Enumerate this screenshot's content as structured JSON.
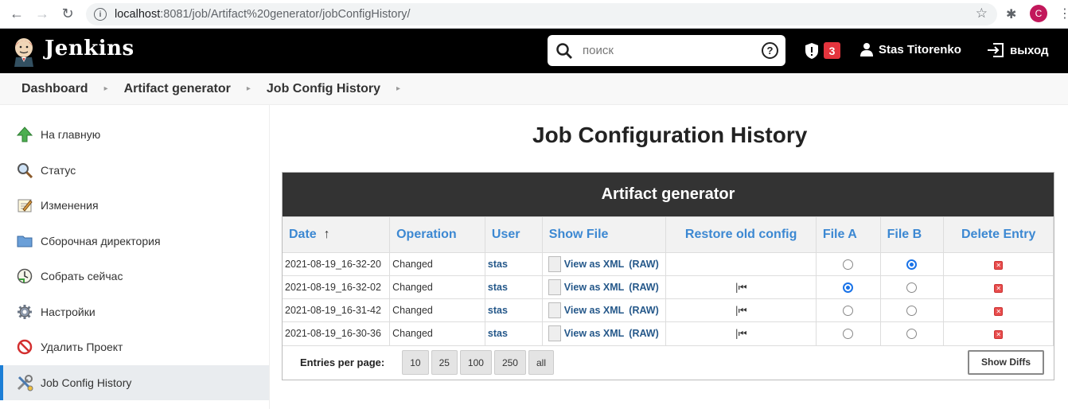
{
  "browser": {
    "url_host": "localhost",
    "url_rest": ":8081/job/Artifact%20generator/jobConfigHistory/",
    "profile_initial": "C"
  },
  "header": {
    "title": "Jenkins",
    "search_placeholder": "поиск",
    "help_glyph": "?",
    "alert_count": "3",
    "user_name": "Stas Titorenko",
    "logout_label": "выход"
  },
  "breadcrumb": [
    "Dashboard",
    "Artifact generator",
    "Job Config History"
  ],
  "sidebar": {
    "items": [
      {
        "label": "На главную",
        "icon": "up-arrow-icon"
      },
      {
        "label": "Статус",
        "icon": "magnifier-icon"
      },
      {
        "label": "Изменения",
        "icon": "notepad-icon"
      },
      {
        "label": "Сборочная директория",
        "icon": "folder-icon"
      },
      {
        "label": "Собрать сейчас",
        "icon": "clock-icon"
      },
      {
        "label": "Настройки",
        "icon": "gear-icon"
      },
      {
        "label": "Удалить Проект",
        "icon": "no-entry-icon"
      },
      {
        "label": "Job Config History",
        "icon": "tools-icon"
      }
    ]
  },
  "main": {
    "page_title": "Job Configuration History",
    "panel_title": "Artifact generator",
    "columns": [
      "Date",
      "Operation",
      "User",
      "Show File",
      "Restore old config",
      "File A",
      "File B",
      "Delete Entry"
    ],
    "sort_indicator": "↑",
    "rows": [
      {
        "date": "2021-08-19_16-32-20",
        "operation": "Changed",
        "user": "stas",
        "view": "View as XML",
        "raw": "(RAW)",
        "restore": "",
        "fileA": false,
        "fileB": true
      },
      {
        "date": "2021-08-19_16-32-02",
        "operation": "Changed",
        "user": "stas",
        "view": "View as XML",
        "raw": "(RAW)",
        "restore": "|⏮",
        "fileA": true,
        "fileB": false
      },
      {
        "date": "2021-08-19_16-31-42",
        "operation": "Changed",
        "user": "stas",
        "view": "View as XML",
        "raw": "(RAW)",
        "restore": "|⏮",
        "fileA": false,
        "fileB": false
      },
      {
        "date": "2021-08-19_16-30-36",
        "operation": "Changed",
        "user": "stas",
        "view": "View as XML",
        "raw": "(RAW)",
        "restore": "|⏮",
        "fileA": false,
        "fileB": false
      }
    ],
    "entries_per_page_label": "Entries per page:",
    "page_sizes": [
      "10",
      "25",
      "100",
      "250",
      "all"
    ],
    "show_diffs_label": "Show Diffs"
  },
  "colors": {
    "accent": "#3c88d2",
    "header_bg": "#000000",
    "badge": "#e4343d"
  }
}
